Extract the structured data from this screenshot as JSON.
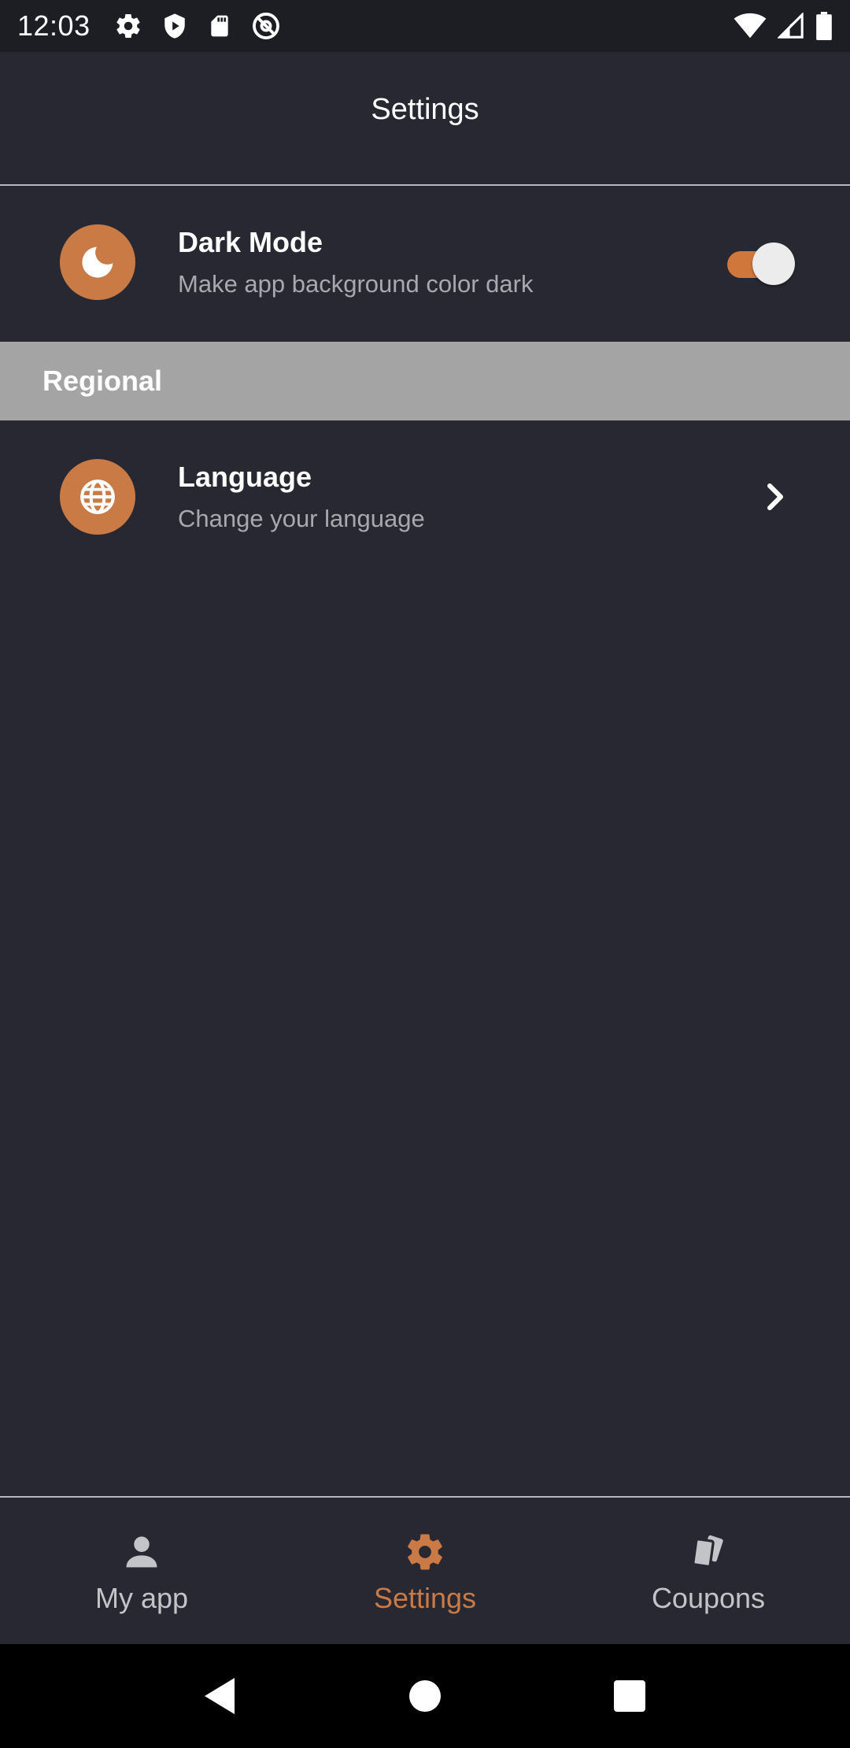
{
  "status_bar": {
    "time": "12:03",
    "left_icons": [
      "gear-icon",
      "shield-icon",
      "sd-card-icon",
      "at-sign-icon"
    ],
    "right_icons": [
      "wifi-icon",
      "cell-signal-icon",
      "battery-icon"
    ]
  },
  "app_bar": {
    "title": "Settings"
  },
  "settings": {
    "dark_mode": {
      "title": "Dark Mode",
      "subtitle": "Make app background color dark",
      "icon": "moon-icon",
      "enabled": true
    },
    "section_regional": {
      "label": "Regional"
    },
    "language": {
      "title": "Language",
      "subtitle": "Change your language",
      "icon": "globe-icon"
    }
  },
  "bottom_nav": {
    "items": [
      {
        "label": "My app",
        "icon": "person-icon",
        "active": false
      },
      {
        "label": "Settings",
        "icon": "gear-icon",
        "active": true
      },
      {
        "label": "Coupons",
        "icon": "coupon-cards-icon",
        "active": false
      }
    ]
  },
  "colors": {
    "background": "#282832",
    "accent": "#c97a45",
    "section_header": "#a4a4a4",
    "muted_text": "#a8a8ae"
  }
}
